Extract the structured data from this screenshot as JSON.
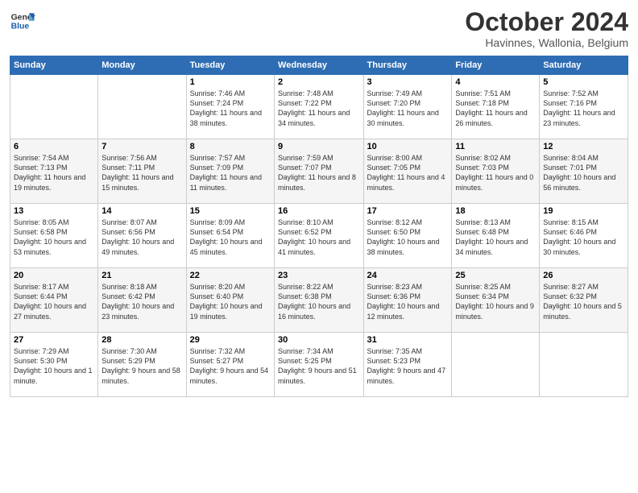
{
  "header": {
    "logo_line1": "General",
    "logo_line2": "Blue",
    "month": "October 2024",
    "location": "Havinnes, Wallonia, Belgium"
  },
  "days_of_week": [
    "Sunday",
    "Monday",
    "Tuesday",
    "Wednesday",
    "Thursday",
    "Friday",
    "Saturday"
  ],
  "weeks": [
    [
      {
        "day": "",
        "info": ""
      },
      {
        "day": "",
        "info": ""
      },
      {
        "day": "1",
        "info": "Sunrise: 7:46 AM\nSunset: 7:24 PM\nDaylight: 11 hours and 38 minutes."
      },
      {
        "day": "2",
        "info": "Sunrise: 7:48 AM\nSunset: 7:22 PM\nDaylight: 11 hours and 34 minutes."
      },
      {
        "day": "3",
        "info": "Sunrise: 7:49 AM\nSunset: 7:20 PM\nDaylight: 11 hours and 30 minutes."
      },
      {
        "day": "4",
        "info": "Sunrise: 7:51 AM\nSunset: 7:18 PM\nDaylight: 11 hours and 26 minutes."
      },
      {
        "day": "5",
        "info": "Sunrise: 7:52 AM\nSunset: 7:16 PM\nDaylight: 11 hours and 23 minutes."
      }
    ],
    [
      {
        "day": "6",
        "info": "Sunrise: 7:54 AM\nSunset: 7:13 PM\nDaylight: 11 hours and 19 minutes."
      },
      {
        "day": "7",
        "info": "Sunrise: 7:56 AM\nSunset: 7:11 PM\nDaylight: 11 hours and 15 minutes."
      },
      {
        "day": "8",
        "info": "Sunrise: 7:57 AM\nSunset: 7:09 PM\nDaylight: 11 hours and 11 minutes."
      },
      {
        "day": "9",
        "info": "Sunrise: 7:59 AM\nSunset: 7:07 PM\nDaylight: 11 hours and 8 minutes."
      },
      {
        "day": "10",
        "info": "Sunrise: 8:00 AM\nSunset: 7:05 PM\nDaylight: 11 hours and 4 minutes."
      },
      {
        "day": "11",
        "info": "Sunrise: 8:02 AM\nSunset: 7:03 PM\nDaylight: 11 hours and 0 minutes."
      },
      {
        "day": "12",
        "info": "Sunrise: 8:04 AM\nSunset: 7:01 PM\nDaylight: 10 hours and 56 minutes."
      }
    ],
    [
      {
        "day": "13",
        "info": "Sunrise: 8:05 AM\nSunset: 6:58 PM\nDaylight: 10 hours and 53 minutes."
      },
      {
        "day": "14",
        "info": "Sunrise: 8:07 AM\nSunset: 6:56 PM\nDaylight: 10 hours and 49 minutes."
      },
      {
        "day": "15",
        "info": "Sunrise: 8:09 AM\nSunset: 6:54 PM\nDaylight: 10 hours and 45 minutes."
      },
      {
        "day": "16",
        "info": "Sunrise: 8:10 AM\nSunset: 6:52 PM\nDaylight: 10 hours and 41 minutes."
      },
      {
        "day": "17",
        "info": "Sunrise: 8:12 AM\nSunset: 6:50 PM\nDaylight: 10 hours and 38 minutes."
      },
      {
        "day": "18",
        "info": "Sunrise: 8:13 AM\nSunset: 6:48 PM\nDaylight: 10 hours and 34 minutes."
      },
      {
        "day": "19",
        "info": "Sunrise: 8:15 AM\nSunset: 6:46 PM\nDaylight: 10 hours and 30 minutes."
      }
    ],
    [
      {
        "day": "20",
        "info": "Sunrise: 8:17 AM\nSunset: 6:44 PM\nDaylight: 10 hours and 27 minutes."
      },
      {
        "day": "21",
        "info": "Sunrise: 8:18 AM\nSunset: 6:42 PM\nDaylight: 10 hours and 23 minutes."
      },
      {
        "day": "22",
        "info": "Sunrise: 8:20 AM\nSunset: 6:40 PM\nDaylight: 10 hours and 19 minutes."
      },
      {
        "day": "23",
        "info": "Sunrise: 8:22 AM\nSunset: 6:38 PM\nDaylight: 10 hours and 16 minutes."
      },
      {
        "day": "24",
        "info": "Sunrise: 8:23 AM\nSunset: 6:36 PM\nDaylight: 10 hours and 12 minutes."
      },
      {
        "day": "25",
        "info": "Sunrise: 8:25 AM\nSunset: 6:34 PM\nDaylight: 10 hours and 9 minutes."
      },
      {
        "day": "26",
        "info": "Sunrise: 8:27 AM\nSunset: 6:32 PM\nDaylight: 10 hours and 5 minutes."
      }
    ],
    [
      {
        "day": "27",
        "info": "Sunrise: 7:29 AM\nSunset: 5:30 PM\nDaylight: 10 hours and 1 minute."
      },
      {
        "day": "28",
        "info": "Sunrise: 7:30 AM\nSunset: 5:29 PM\nDaylight: 9 hours and 58 minutes."
      },
      {
        "day": "29",
        "info": "Sunrise: 7:32 AM\nSunset: 5:27 PM\nDaylight: 9 hours and 54 minutes."
      },
      {
        "day": "30",
        "info": "Sunrise: 7:34 AM\nSunset: 5:25 PM\nDaylight: 9 hours and 51 minutes."
      },
      {
        "day": "31",
        "info": "Sunrise: 7:35 AM\nSunset: 5:23 PM\nDaylight: 9 hours and 47 minutes."
      },
      {
        "day": "",
        "info": ""
      },
      {
        "day": "",
        "info": ""
      }
    ]
  ]
}
